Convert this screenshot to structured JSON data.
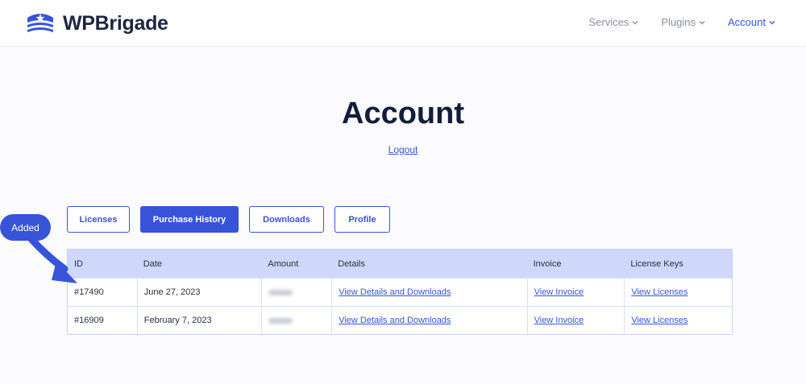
{
  "brand": {
    "name": "WPBrigade"
  },
  "nav": [
    {
      "label": "Services",
      "active": false
    },
    {
      "label": "Plugins",
      "active": false
    },
    {
      "label": "Account",
      "active": true
    }
  ],
  "page": {
    "title": "Account",
    "logout": "Logout"
  },
  "tabs": [
    {
      "label": "Licenses",
      "active": false
    },
    {
      "label": "Purchase History",
      "active": true
    },
    {
      "label": "Downloads",
      "active": false
    },
    {
      "label": "Profile",
      "active": false
    }
  ],
  "table": {
    "headers": [
      "ID",
      "Date",
      "Amount",
      "Details",
      "Invoice",
      "License Keys"
    ],
    "rows": [
      {
        "id": "#17490",
        "date": "June 27, 2023",
        "amount": "",
        "details": "View Details and Downloads",
        "invoice": "View Invoice",
        "licenses": "View Licenses"
      },
      {
        "id": "#16909",
        "date": "February 7, 2023",
        "amount": "",
        "details": "View Details and Downloads",
        "invoice": "View Invoice",
        "licenses": "View Licenses"
      }
    ]
  },
  "annotation": {
    "label": "Added"
  },
  "colors": {
    "accent": "#3754d8",
    "header_row": "#cfd8fb",
    "title": "#131d3d"
  }
}
